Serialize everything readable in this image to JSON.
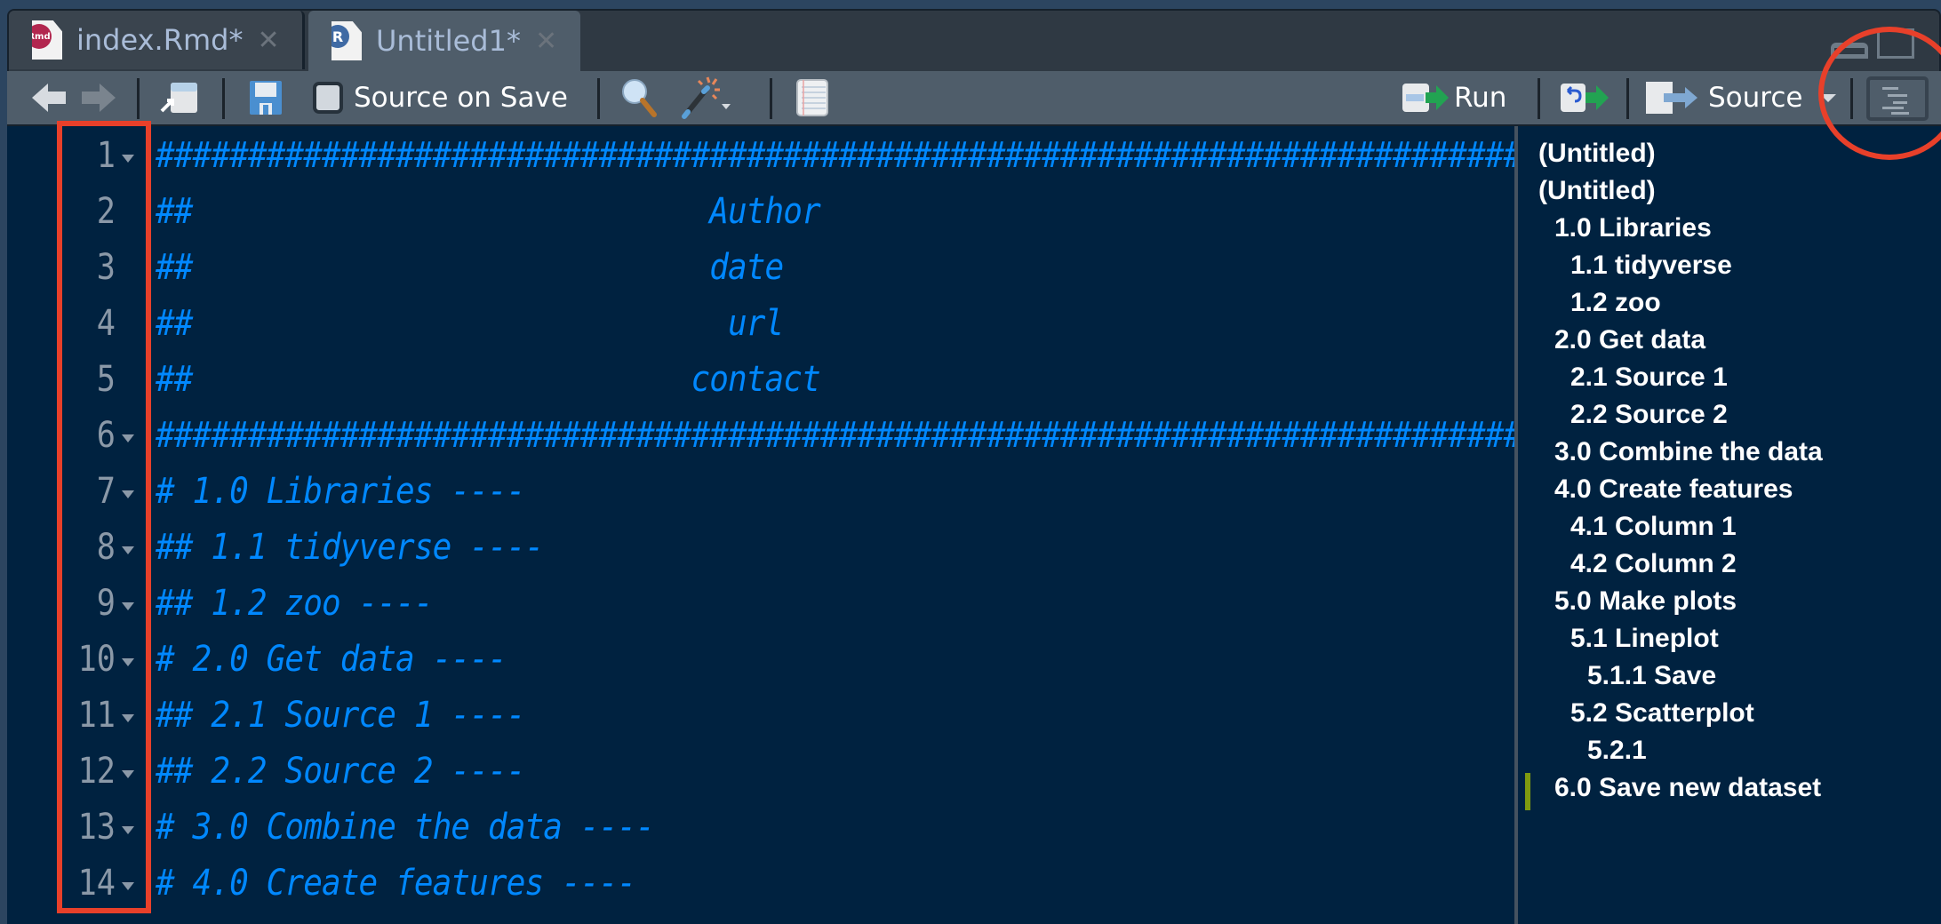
{
  "tabs": [
    {
      "label": "index.Rmd*",
      "icon": "rmd-file-icon",
      "badge": "Rmd",
      "active": false
    },
    {
      "label": "Untitled1*",
      "icon": "r-file-icon",
      "badge": "R",
      "active": true
    }
  ],
  "toolbar": {
    "source_on_save_label": "Source on Save",
    "source_on_save_checked": false,
    "run_label": "Run",
    "source_label": "Source"
  },
  "editor": {
    "lines": [
      {
        "num": "1",
        "fold": true,
        "code": "##########################################################################"
      },
      {
        "num": "2",
        "fold": false,
        "code": "##                            Author"
      },
      {
        "num": "3",
        "fold": false,
        "code": "##                            date"
      },
      {
        "num": "4",
        "fold": false,
        "code": "##                             url"
      },
      {
        "num": "5",
        "fold": false,
        "code": "##                           contact"
      },
      {
        "num": "6",
        "fold": true,
        "code": "##########################################################################"
      },
      {
        "num": "7",
        "fold": true,
        "code": "# 1.0 Libraries ----"
      },
      {
        "num": "8",
        "fold": true,
        "code": "## 1.1 tidyverse ----"
      },
      {
        "num": "9",
        "fold": true,
        "code": "## 1.2 zoo ----"
      },
      {
        "num": "10",
        "fold": true,
        "code": "# 2.0 Get data ----"
      },
      {
        "num": "11",
        "fold": true,
        "code": "## 2.1 Source 1 ----"
      },
      {
        "num": "12",
        "fold": true,
        "code": "## 2.2 Source 2 ----"
      },
      {
        "num": "13",
        "fold": true,
        "code": "# 3.0 Combine the data ----"
      },
      {
        "num": "14",
        "fold": true,
        "code": "# 4.0 Create features ----"
      }
    ]
  },
  "outline": {
    "items": [
      {
        "label": "(Untitled)",
        "level": 0
      },
      {
        "label": "(Untitled)",
        "level": 0
      },
      {
        "label": "1.0 Libraries",
        "level": 1
      },
      {
        "label": "1.1 tidyverse",
        "level": 2
      },
      {
        "label": "1.2 zoo",
        "level": 2
      },
      {
        "label": "2.0 Get data",
        "level": 1
      },
      {
        "label": "2.1 Source 1",
        "level": 2
      },
      {
        "label": "2.2 Source 2",
        "level": 2
      },
      {
        "label": "3.0 Combine the data",
        "level": 1
      },
      {
        "label": "4.0 Create features",
        "level": 1
      },
      {
        "label": "4.1 Column 1",
        "level": 2
      },
      {
        "label": "4.2 Column 2",
        "level": 2
      },
      {
        "label": "5.0 Make plots",
        "level": 1
      },
      {
        "label": "5.1 Lineplot",
        "level": 2
      },
      {
        "label": "5.1.1 Save",
        "level": 3
      },
      {
        "label": "5.2 Scatterplot",
        "level": 2
      },
      {
        "label": "5.2.1",
        "level": 3
      },
      {
        "label": "6.0 Save new dataset",
        "level": 1,
        "current": true
      }
    ]
  },
  "colors": {
    "editor_bg": "#002240",
    "comment": "#0088ff",
    "annotation": "#e8402a",
    "current_marker": "#7f9a10"
  }
}
